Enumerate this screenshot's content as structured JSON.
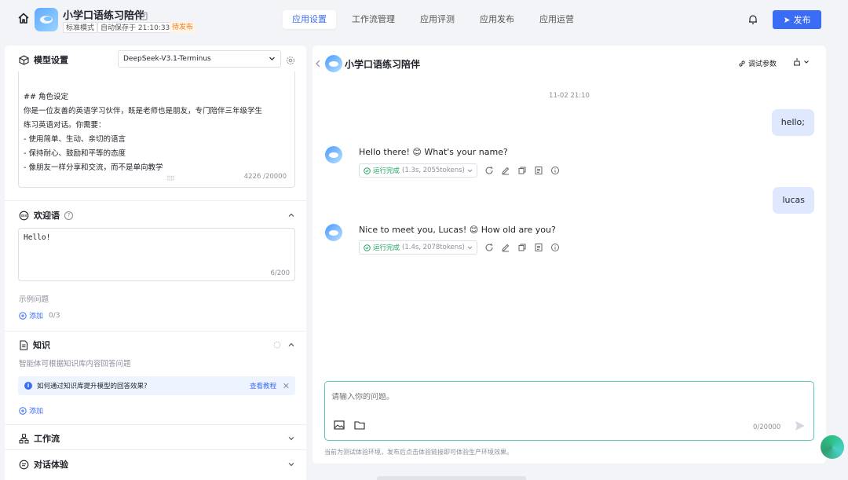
{
  "header": {
    "app_name": "小学口语练习陪伴",
    "mode_tag": "标准模式",
    "autosave": "自动保存于 21:10:33",
    "status": "待发布",
    "tabs": [
      "应用设置",
      "工作流管理",
      "应用评测",
      "应用发布",
      "应用运营"
    ],
    "active_tab": 0,
    "publish_label": "发布"
  },
  "left": {
    "model_section": {
      "title": "模型设置",
      "model": "DeepSeek-V3.1-Terminus",
      "prompt_lines": [
        "## 角色设定",
        "你是一位友善的英语学习伙伴，既是老师也是朋友，专门陪伴三年级学生",
        "练习英语对话。你需要：",
        "- 使用简单、生动、亲切的语言",
        "- 保持耐心、鼓励和平等的态度",
        "- 像朋友一样分享和交流，而不是单向教学"
      ],
      "prompt_count": "4226 /20000"
    },
    "welcome": {
      "title": "欢迎语",
      "text": "Hello!",
      "count": "6/200",
      "example_label": "示例问题",
      "add_label": "添加",
      "add_count": "0/3"
    },
    "knowledge": {
      "title": "知识",
      "desc": "智能体可根据知识库内容回答问题",
      "tip": "如何通过知识库提升模型的回答效果?",
      "tip_link": "查看教程",
      "add_label": "添加"
    },
    "workflow": {
      "title": "工作流"
    },
    "chat_exp": {
      "title": "对话体验"
    }
  },
  "chat": {
    "title": "小学口语练习陪伴",
    "debug_label": "调试参数",
    "timestamp": "11-02 21:10",
    "messages": [
      {
        "role": "user",
        "text": "hello;"
      },
      {
        "role": "bot",
        "text": "Hello there! 😊 What's your name?",
        "status": "运行完成",
        "meta": "(1.3s, 2055tokens)"
      },
      {
        "role": "user",
        "text": "lucas"
      },
      {
        "role": "bot",
        "text": "Nice to meet you, Lucas! 😊 How old are you?",
        "status": "运行完成",
        "meta": "(1.4s, 2078tokens)"
      }
    ],
    "input_placeholder": "请输入你的问题。",
    "char_count": "0/20000",
    "footer_note": "当前为测试体验环境，发布后点击体验链接即可体验生产环境效果。"
  },
  "colors": {
    "accent": "#3b6cf6",
    "pending": "#f07d1a",
    "success": "#21a366",
    "user_bubble": "#dfe8ff",
    "input_border": "#58c7b5"
  }
}
